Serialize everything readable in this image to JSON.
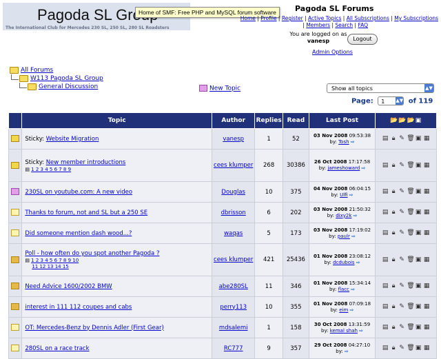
{
  "header": {
    "logo_title": "Pagoda SL Group",
    "logo_subtitle": "The International Club for Mercedes 230 SL, 250 SL, 280 SL Roadsters",
    "tooltip": "Home of SMF: Free PHP and MySQL forum software",
    "forum_name": "Pagoda SL Forums",
    "links_row1": [
      "Home",
      "Profile",
      "Register",
      "Active Topics",
      "All Subscriptions",
      "My Subscriptions"
    ],
    "links_row2": [
      "Members",
      "Search",
      "FAQ"
    ],
    "logged_text": "You are logged on as",
    "username": "vanesp",
    "logout": "Logout",
    "admin_options": "Admin Options"
  },
  "breadcrumbs": [
    "All Forums",
    "W113 Pagoda SL Group",
    "General Discussion"
  ],
  "new_topic": "New Topic",
  "filter": {
    "selected": "Show all topics"
  },
  "pager": {
    "label": "Page:",
    "current": "1",
    "of": "of 119"
  },
  "table": {
    "columns": [
      "Topic",
      "Author",
      "Replies",
      "Read",
      "Last Post"
    ],
    "rows": [
      {
        "topic": "Sticky: ",
        "link": "Website Migration",
        "pages": "",
        "pages2": "",
        "author": "vanesp",
        "replies": "1",
        "read": "52",
        "date": "03 Nov 2008",
        "time": "09:53:38",
        "by": "by:",
        "lastby": "Tosh",
        "icon": "sticky"
      },
      {
        "topic": "Sticky: ",
        "link": "New member introductions",
        "pages": "1 2 3 4 5 6 7 8 9",
        "pages2": "",
        "author": "cees klumper",
        "replies": "268",
        "read": "30386",
        "date": "26 Oct 2008",
        "time": "17:17:58",
        "by": "by:",
        "lastby": "jameshoward",
        "icon": "sticky"
      },
      {
        "topic": "",
        "link": "230SL on youtube.com: A new video",
        "pages": "",
        "pages2": "",
        "author": "Douglas",
        "replies": "10",
        "read": "375",
        "date": "04 Nov 2008",
        "time": "06:04:15",
        "by": "by:",
        "lastby": "Ulfi",
        "icon": "moved"
      },
      {
        "topic": "",
        "link": "Thanks to forum, not and SL but a 250 SE",
        "pages": "",
        "pages2": "",
        "author": "dbrisson",
        "replies": "6",
        "read": "202",
        "date": "03 Nov 2008",
        "time": "21:50:32",
        "by": "by:",
        "lastby": "dixy2k",
        "icon": "plain"
      },
      {
        "topic": "",
        "link": "Did someone mention dash wood...?",
        "pages": "",
        "pages2": "",
        "author": "waqas",
        "replies": "5",
        "read": "173",
        "date": "03 Nov 2008",
        "time": "17:19:02",
        "by": "by:",
        "lastby": "paulr",
        "icon": "plain"
      },
      {
        "topic": "",
        "link": "Poll - how often do you spot another Pagoda ?",
        "pages": "1 2 3 4 5 6 7 8 9 10",
        "pages2": "11 12 13 14 15",
        "author": "cees klumper",
        "replies": "421",
        "read": "25436",
        "date": "01 Nov 2008",
        "time": "23:08:12",
        "by": "by:",
        "lastby": "dcdubois",
        "icon": "poll"
      },
      {
        "topic": "",
        "link": "Need Advice 1600/2002 BMW",
        "pages": "",
        "pages2": "",
        "author": "abe280SL",
        "replies": "11",
        "read": "346",
        "date": "01 Nov 2008",
        "time": "15:34:14",
        "by": "by:",
        "lastby": "flacc",
        "icon": "poll"
      },
      {
        "topic": "",
        "link": "interest in 111 112 coupes and cabs",
        "pages": "",
        "pages2": "",
        "author": "perry113",
        "replies": "10",
        "read": "355",
        "date": "01 Nov 2008",
        "time": "07:09:18",
        "by": "by:",
        "lastby": "eim",
        "icon": "poll"
      },
      {
        "topic": "",
        "link": "OT: Mercedes-Benz by Dennis Adler (First Gear)",
        "pages": "",
        "pages2": "",
        "author": "mdsalemi",
        "replies": "1",
        "read": "158",
        "date": "30 Oct 2008",
        "time": "13:31:59",
        "by": "by:",
        "lastby": "kemal shah",
        "icon": "plain"
      },
      {
        "topic": "",
        "link": "280SL on a race track",
        "pages": "",
        "pages2": "",
        "author": "RC777",
        "replies": "9",
        "read": "357",
        "date": "29 Oct 2008",
        "time": "04:27:10",
        "by": "by:",
        "lastby": "",
        "icon": "plain"
      }
    ]
  },
  "colors": {
    "header_bg": "#20317a",
    "link": "#0000cc",
    "logo_bg": "#dbe2ee"
  }
}
